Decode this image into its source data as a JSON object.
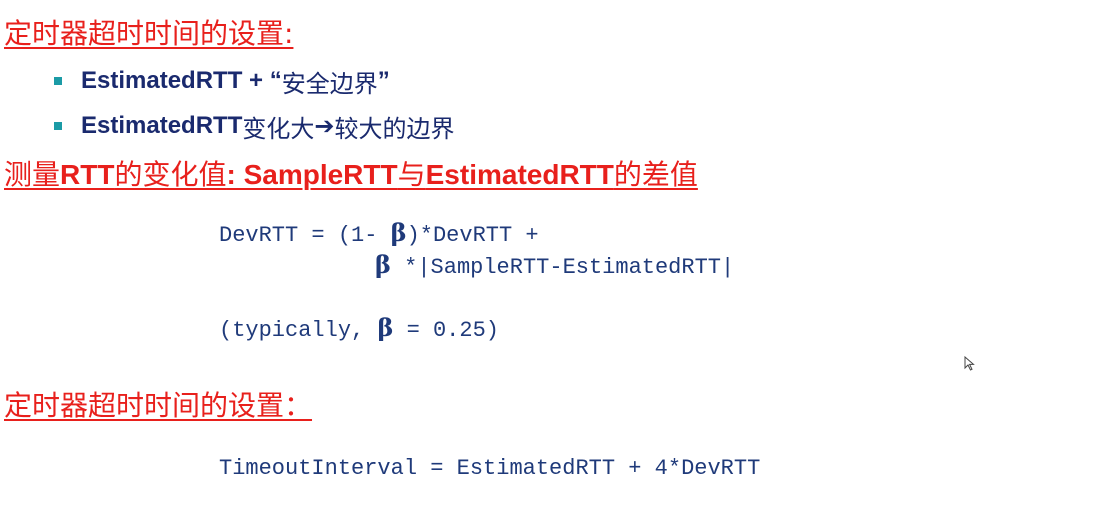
{
  "heading1": {
    "text": "定时器超时时间的设置:"
  },
  "bullets": [
    {
      "en": "EstimatedRTT + “",
      "cn": "安全边界",
      "tail": "”"
    },
    {
      "en": "EstimatedRTT",
      "cn": "变化大",
      "arrow": "➔",
      "cn2": "较大的边界"
    }
  ],
  "heading2": {
    "p1": "测量",
    "p2": "RTT",
    "p3": "的变化值",
    "p4": ": SampleRTT",
    "p5": "与",
    "p6": "EstimatedRTT",
    "p7": "的差值"
  },
  "formula1": {
    "line1_a": "DevRTT = (1- ",
    "beta": "β",
    "line1_b": ")*DevRTT +",
    "line2_b": " *|SampleRTT-EstimatedRTT|",
    "typ_a": "(typically, ",
    "typ_b": " = 0.25)"
  },
  "heading3": {
    "text": "定时器超时时间的设置："
  },
  "formula2": {
    "text": "TimeoutInterval = EstimatedRTT + 4*DevRTT"
  },
  "colors": {
    "heading": "#e8201c",
    "bullet_text": "#1a2a6e",
    "bullet_mark": "#1b9ba6",
    "code": "#1f3a7a"
  },
  "icons": {
    "cursor": "mouse-pointer-icon"
  }
}
